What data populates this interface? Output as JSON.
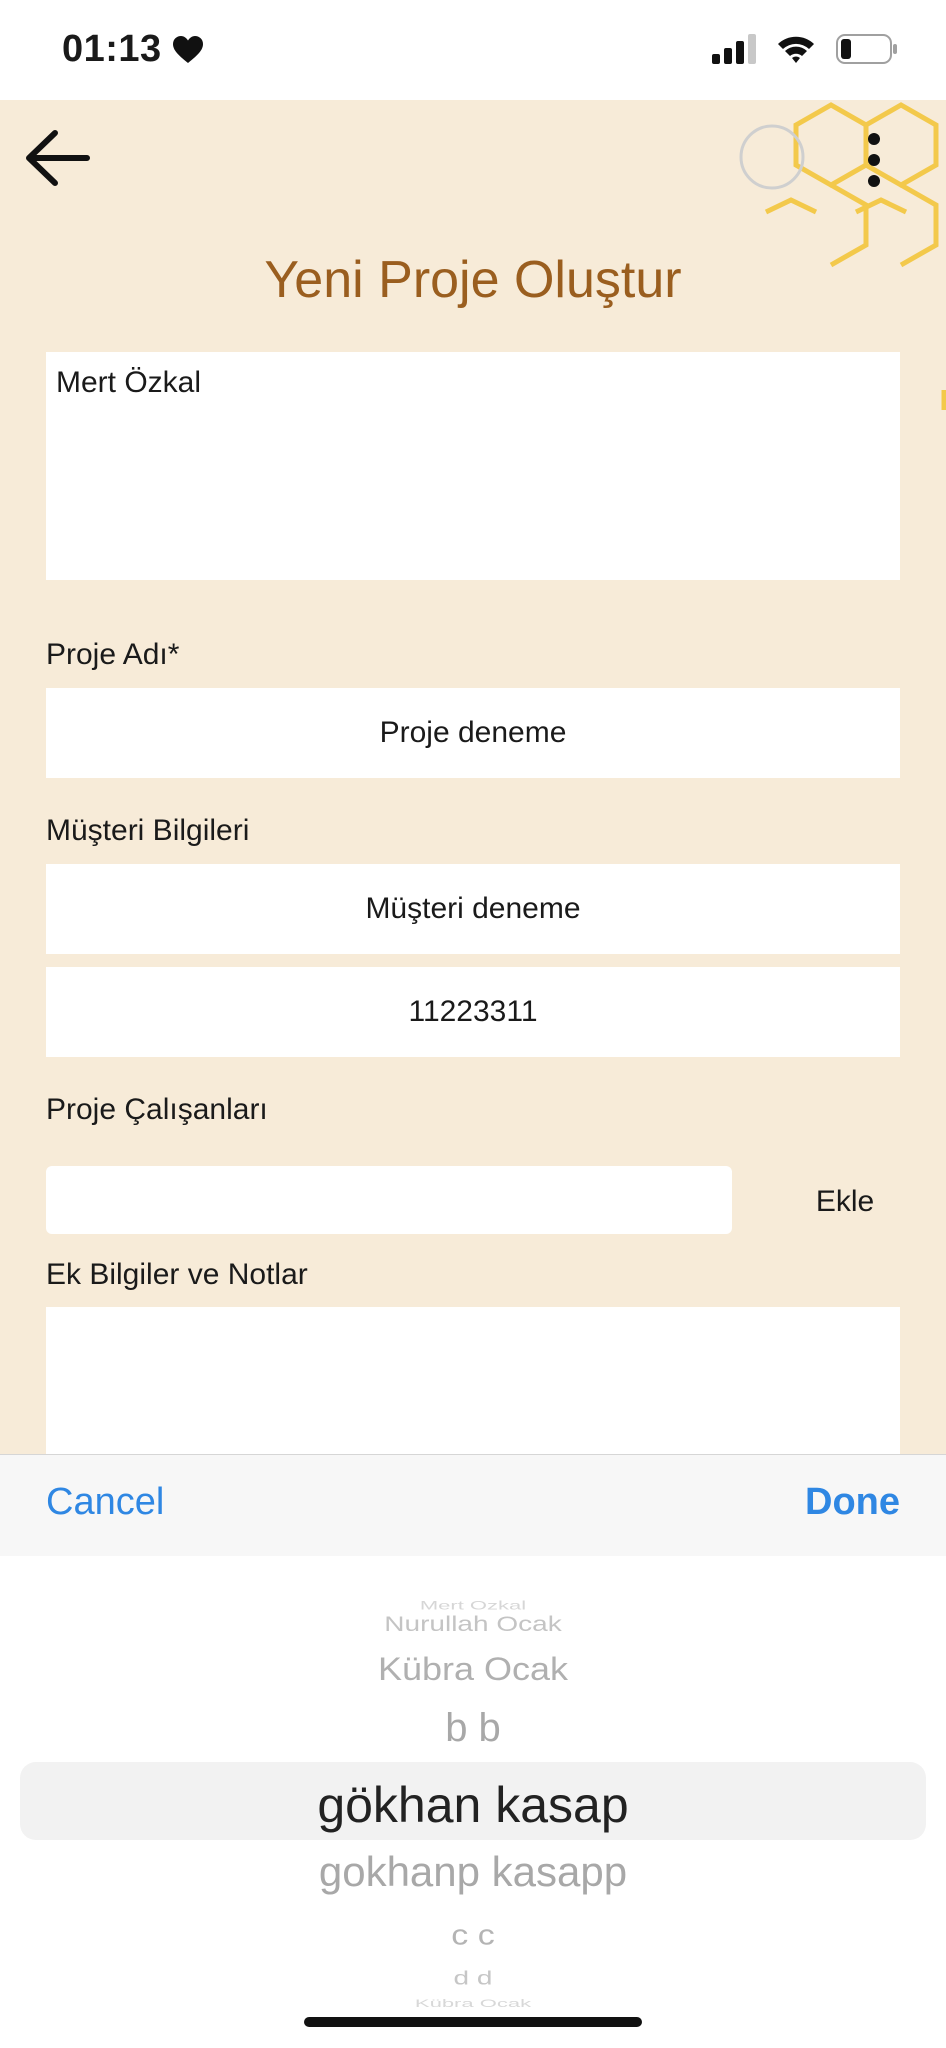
{
  "status_bar": {
    "time": "01:13",
    "heart_icon": "heart-icon",
    "signal_icon": "cellular-signal-icon",
    "wifi_icon": "wifi-icon",
    "battery_icon": "battery-low-icon"
  },
  "header": {
    "back_icon": "arrow-left-icon",
    "menu_icon": "vertical-ellipsis-icon",
    "title": "Yeni Proje Oluştur"
  },
  "form": {
    "owner_name": "Mert Özkal",
    "project_name_label": "Proje Adı*",
    "project_name_value": "Proje deneme",
    "customer_label": "Müşteri Bilgileri",
    "customer_name_value": "Müşteri deneme",
    "customer_phone_value": "11223311",
    "employees_label": "Proje Çalışanları",
    "employee_input_value": "",
    "add_button_label": "Ekle",
    "notes_label": "Ek Bilgiler ve Notlar",
    "notes_value": ""
  },
  "picker_toolbar": {
    "cancel_label": "Cancel",
    "done_label": "Done"
  },
  "picker": {
    "options": [
      "Mert Özkal",
      "Nurullah  Ocak",
      "Kübra Ocak",
      "b b",
      "gökhan kasap",
      "gokhanp kasapp",
      "c c",
      "d d",
      "Kübra Ocak"
    ],
    "selected": "gökhan kasap"
  },
  "colors": {
    "background": "#f7ebd8",
    "title": "#9a5e1f",
    "accent_blue": "#2f87e3",
    "honeycomb": "#f3c94b"
  }
}
